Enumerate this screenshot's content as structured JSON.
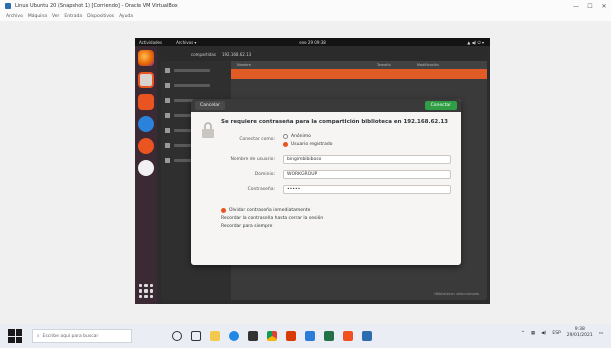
{
  "host_window": {
    "title": "Linux Ubuntu 20 (Snapshot 1) [Corriendo] - Oracle VM VirtualBox",
    "menu": [
      "Archivo",
      "Máquina",
      "Ver",
      "Entrada",
      "Dispositivos",
      "Ayuda"
    ],
    "controls": [
      "—",
      "☐",
      "✕"
    ]
  },
  "gnome": {
    "activities": "Actividades",
    "app_menu": "Archivos ▾",
    "clock": "ene 29 09:38",
    "tray": "▲ ◀) ⏻ ▾"
  },
  "files": {
    "path_segments": [
      "compartidas",
      "192.168.62.13"
    ],
    "column_headers": [
      "Nombre",
      "Tamaño",
      "Modificación"
    ],
    "status": "«Biblioteca» seleccionado"
  },
  "dialog": {
    "cancel_label": "Cancelar",
    "connect_label": "Conectar",
    "heading": "Se requiere contraseña para la compartición biblioteca en 192.168.62.13",
    "connect_as_label": "Conectar como:",
    "anonymous_option": "Anónimo",
    "registered_option": "Usuario registrado",
    "username_label": "Nombre de usuario:",
    "username_value": "bingimbibiboso",
    "domain_label": "Dominio:",
    "domain_value": "WORKGROUP",
    "password_label": "Contraseña:",
    "password_value": "•••••",
    "forget_option": "Olvidar contraseña inmediatamente",
    "remember_session_option": "Recordar la contraseña hasta cerrar la sesión",
    "remember_forever_option": "Recordar para siempre"
  },
  "taskbar": {
    "search_placeholder": "Escribe aquí para buscar",
    "time": "9:38",
    "date": "29/01/2021",
    "lang": "ESP"
  },
  "colors": {
    "ubuntu_orange": "#e95420",
    "dialog_connect_green": "#2f9e44",
    "taskbar_bg": "#eaeef4"
  }
}
